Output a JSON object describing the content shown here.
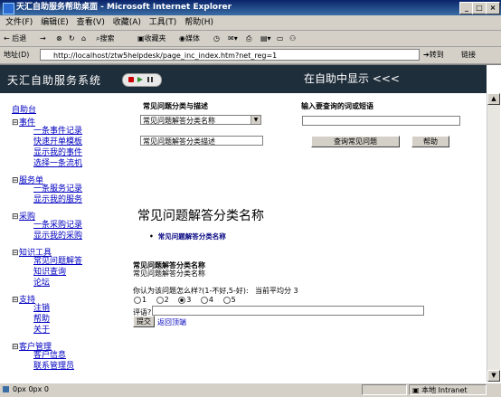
{
  "window": {
    "title": "天汇自助服务帮助桌面 - Microsoft Internet Explorer",
    "controls": [
      "_",
      "□",
      "×"
    ]
  },
  "menu": [
    "文件(F)",
    "编辑(E)",
    "查看(V)",
    "收藏(A)",
    "工具(T)",
    "帮助(H)"
  ],
  "toolbar": {
    "back": "← 后退",
    "forward": "→",
    "search": "搜索",
    "favorites": "收藏夹",
    "media": "媒体"
  },
  "address": {
    "label": "地址(D)",
    "url": "http://localhost/ztw5helpdesk/page_inc_index.htm?net_reg=1",
    "go": "转到",
    "links": "链接"
  },
  "banner": {
    "brand": "天汇自助服务系统",
    "status": "在自助中显示 <<<"
  },
  "nav": {
    "home": "自助台",
    "sections": [
      {
        "title": "事件",
        "items": [
          "一条事件记录",
          "快速开单模板",
          "显示我的事件",
          "选择一条流机"
        ]
      },
      {
        "title": "服务单",
        "items": [
          "一条服务记录",
          "显示我的服务"
        ]
      },
      {
        "title": "采购",
        "items": [
          "一条采购记录",
          "显示我的采购"
        ]
      },
      {
        "title": "知识工具",
        "items": [
          "常见问题解答",
          "知识查询",
          "论坛"
        ]
      },
      {
        "title": "支持",
        "items": [
          "注销",
          "帮助",
          "关于"
        ]
      },
      {
        "title": "客户管理",
        "items": [
          "客户信息",
          "联系管理员"
        ]
      }
    ]
  },
  "faq_form": {
    "category_label": "常见问题分类与描述",
    "category_selected": "常见问题解答分类名称",
    "description_value": "常见问题解答分类描述",
    "query_label": "输入要查询的词或短语",
    "query_value": "",
    "search_button": "查询常见问题",
    "help_button": "帮助"
  },
  "content": {
    "heading": "常见问题解答分类名称",
    "bullet": "常见问题解答分类名称",
    "detail_title": "常见问题解答分类名称",
    "detail_text": "常见问题解答分类名称",
    "rating_question": "你认为该问题怎么样?(1-不好,5-好):",
    "average_label": "当前平均分",
    "average_value": "3",
    "rating_options": [
      "1",
      "2",
      "3",
      "4",
      "5"
    ],
    "rating_selected": 3,
    "comment_label": "评语?",
    "comment_value": "",
    "submit_button": "提交",
    "back_link": "返回顶端"
  },
  "status_bar": {
    "left": "0px 0px 0",
    "zone": "本地 Intranet"
  }
}
